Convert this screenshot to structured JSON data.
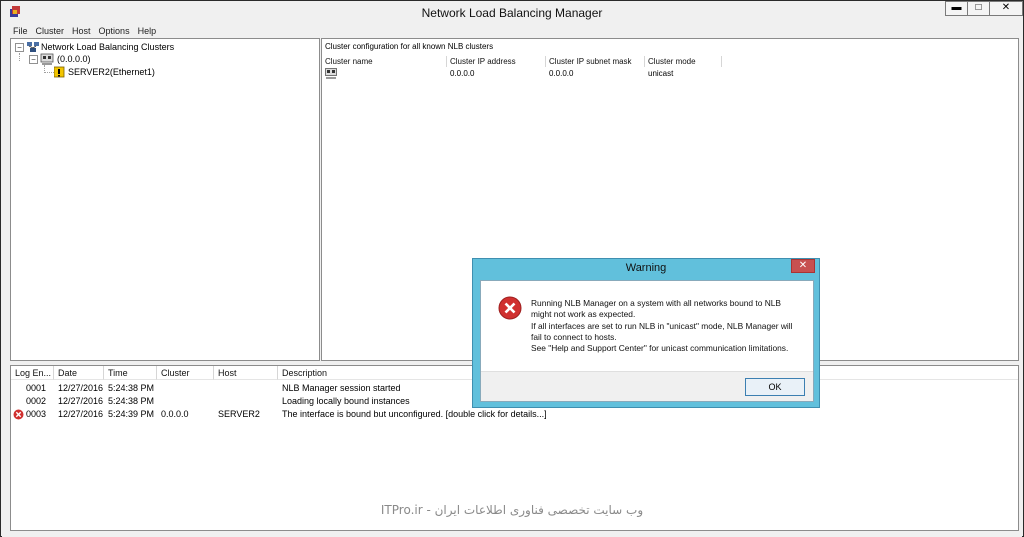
{
  "window": {
    "title": "Network Load Balancing Manager",
    "controls": {
      "minimize": "▬",
      "maximize": "□",
      "close": "✕"
    }
  },
  "menu": [
    "File",
    "Cluster",
    "Host",
    "Options",
    "Help"
  ],
  "tree": {
    "root_label": "Network Load Balancing Clusters",
    "cluster_label": "(0.0.0.0)",
    "host_label": "SERVER2(Ethernet1)",
    "expander_symbol": "−"
  },
  "cluster_panel": {
    "heading": "Cluster configuration for all known NLB clusters",
    "columns": [
      "Cluster name",
      "Cluster IP address",
      "Cluster IP subnet mask",
      "Cluster mode"
    ],
    "rows": [
      {
        "name": "",
        "ip": "0.0.0.0",
        "mask": "0.0.0.0",
        "mode": "unicast"
      }
    ]
  },
  "log": {
    "columns": [
      "Log En...",
      "Date",
      "Time",
      "Cluster",
      "Host",
      "Description"
    ],
    "rows": [
      {
        "entry": "0001",
        "date": "12/27/2016",
        "time": "5:24:38 PM",
        "cluster": "",
        "host": "",
        "description": "NLB Manager session started",
        "error": false
      },
      {
        "entry": "0002",
        "date": "12/27/2016",
        "time": "5:24:38 PM",
        "cluster": "",
        "host": "",
        "description": "Loading locally bound instances",
        "error": false
      },
      {
        "entry": "0003",
        "date": "12/27/2016",
        "time": "5:24:39 PM",
        "cluster": "0.0.0.0",
        "host": "SERVER2",
        "description": "The interface is bound but unconfigured. [double click for details...]",
        "error": true
      }
    ]
  },
  "dialog": {
    "title": "Warning",
    "close_symbol": "✕",
    "message_lines": [
      "Running NLB Manager on a system with all networks bound to NLB",
      "might not work as expected.",
      "If all interfaces are set to run NLB in \"unicast\" mode, NLB Manager will",
      "fail to connect to hosts.",
      "See \"Help and Support Center\" for unicast communication limitations."
    ],
    "ok_label": "OK",
    "icon": "error-icon"
  },
  "watermark": "وب سایت تخصصی فناوری اطلاعات ایران - ITPro.ir",
  "colors": {
    "dialog_frame": "#61c0dc",
    "error_red": "#d0302f",
    "close_red": "#c75050"
  }
}
